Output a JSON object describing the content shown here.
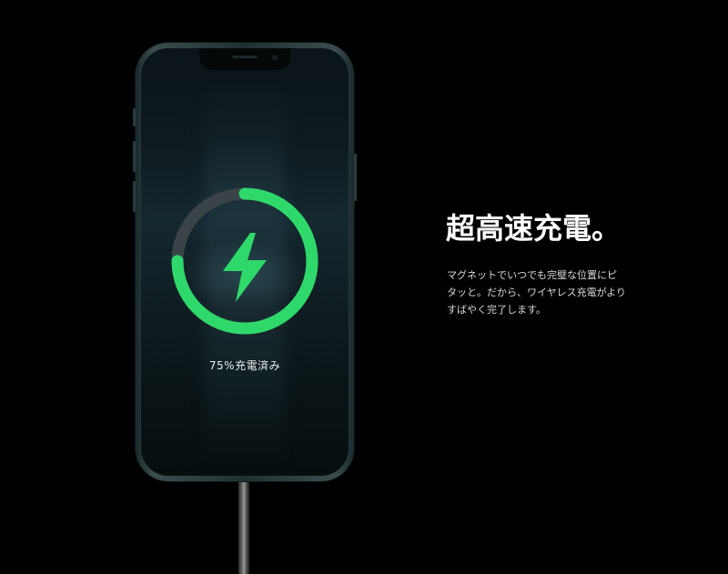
{
  "phone_screen": {
    "charge_status_label": "75%充電済み",
    "charge_percent": 0.75,
    "bolt_icon": "lightning-bolt-icon"
  },
  "marketing": {
    "headline": "超高速充電。",
    "body_lines": [
      "マグネットでいつでも完璧な位置にピ",
      "タッと。だから、ワイヤレス充電がより",
      "すばやく完了します。"
    ]
  },
  "colors": {
    "ring_progress": "#2fd86a",
    "ring_track": "#3a4448",
    "background": "#000000"
  }
}
